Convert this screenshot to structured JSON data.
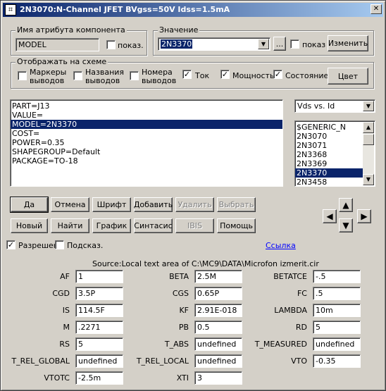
{
  "window": {
    "title": "2N3070:N-Channel JFET BVgss=50V Idss=1.5mA",
    "app_icon": "mc9-icon"
  },
  "attr": {
    "group_label": "Имя атрибута компонента",
    "name_value": "MODEL",
    "show_label": "показ."
  },
  "value": {
    "group_label": "Значение",
    "selected": "2N3370",
    "browse_label": "...",
    "show_label": "показ",
    "change_label": "Изменить"
  },
  "display": {
    "group_label": "Отображать на схеме",
    "markers_label": "Маркеры\nвыводов",
    "names_label": "Названия\nвыводов",
    "numbers_label": "Номера\nвыводов",
    "current_label": "Ток",
    "power_label": "Мощность",
    "state_label": "Состояние",
    "color_label": "Цвет",
    "markers_checked": false,
    "names_checked": false,
    "numbers_checked": false,
    "current_checked": true,
    "power_checked": true,
    "state_checked": true
  },
  "attributes_list": [
    "PART=J13",
    "VALUE=",
    "MODEL=2N3370",
    "COST=",
    "POWER=0.35",
    "SHAPEGROUP=Default",
    "PACKAGE=TO-18"
  ],
  "attributes_selected_index": 2,
  "plot_select": "Vds vs. Id",
  "models_list": [
    "$GENERIC_N",
    "2N3070",
    "2N3071",
    "2N3368",
    "2N3369",
    "2N3370",
    "2N3458"
  ],
  "models_selected_index": 5,
  "buttons_row1": {
    "ok": "Да",
    "cancel": "Отмена",
    "font": "Шрифт",
    "add": "Добавить",
    "delete": "Удалить",
    "select": "Выбрать"
  },
  "buttons_row2": {
    "new": "Новый",
    "find": "Найти",
    "graph": "График",
    "syntax": "Синтасис",
    "ibis": "IBIS",
    "help": "Помощь"
  },
  "options": {
    "enabled_label": "Разрешен",
    "enabled_checked": true,
    "hint_label": "Подсказ.",
    "hint_checked": false,
    "link_label": "Ссылка"
  },
  "source_text": "Source:Local text area of C:\\MC9\\DATA\\Microfon izmerit.cir",
  "params": [
    {
      "name": "AF",
      "value": "1"
    },
    {
      "name": "BETA",
      "value": "2.5M"
    },
    {
      "name": "BETATCE",
      "value": "-.5"
    },
    {
      "name": "CGD",
      "value": "3.5P"
    },
    {
      "name": "CGS",
      "value": "0.65P"
    },
    {
      "name": "FC",
      "value": ".5"
    },
    {
      "name": "IS",
      "value": "114.5F"
    },
    {
      "name": "KF",
      "value": "2.91E-018"
    },
    {
      "name": "LAMBDA",
      "value": "10m"
    },
    {
      "name": "M",
      "value": ".2271"
    },
    {
      "name": "PB",
      "value": "0.5"
    },
    {
      "name": "RD",
      "value": "5"
    },
    {
      "name": "RS",
      "value": "5"
    },
    {
      "name": "T_ABS",
      "value": "undefined"
    },
    {
      "name": "T_MEASURED",
      "value": "undefined"
    },
    {
      "name": "T_REL_GLOBAL",
      "value": "undefined"
    },
    {
      "name": "T_REL_LOCAL",
      "value": "undefined"
    },
    {
      "name": "VTO",
      "value": "-0.35"
    },
    {
      "name": "VTOTC",
      "value": "-2.5m"
    },
    {
      "name": "XTI",
      "value": "3"
    }
  ],
  "colors": {
    "title_start": "#0a246a",
    "title_end": "#a6caf0",
    "selection": "#0a246a",
    "face": "#d4d0c8",
    "link": "#0000ff"
  }
}
